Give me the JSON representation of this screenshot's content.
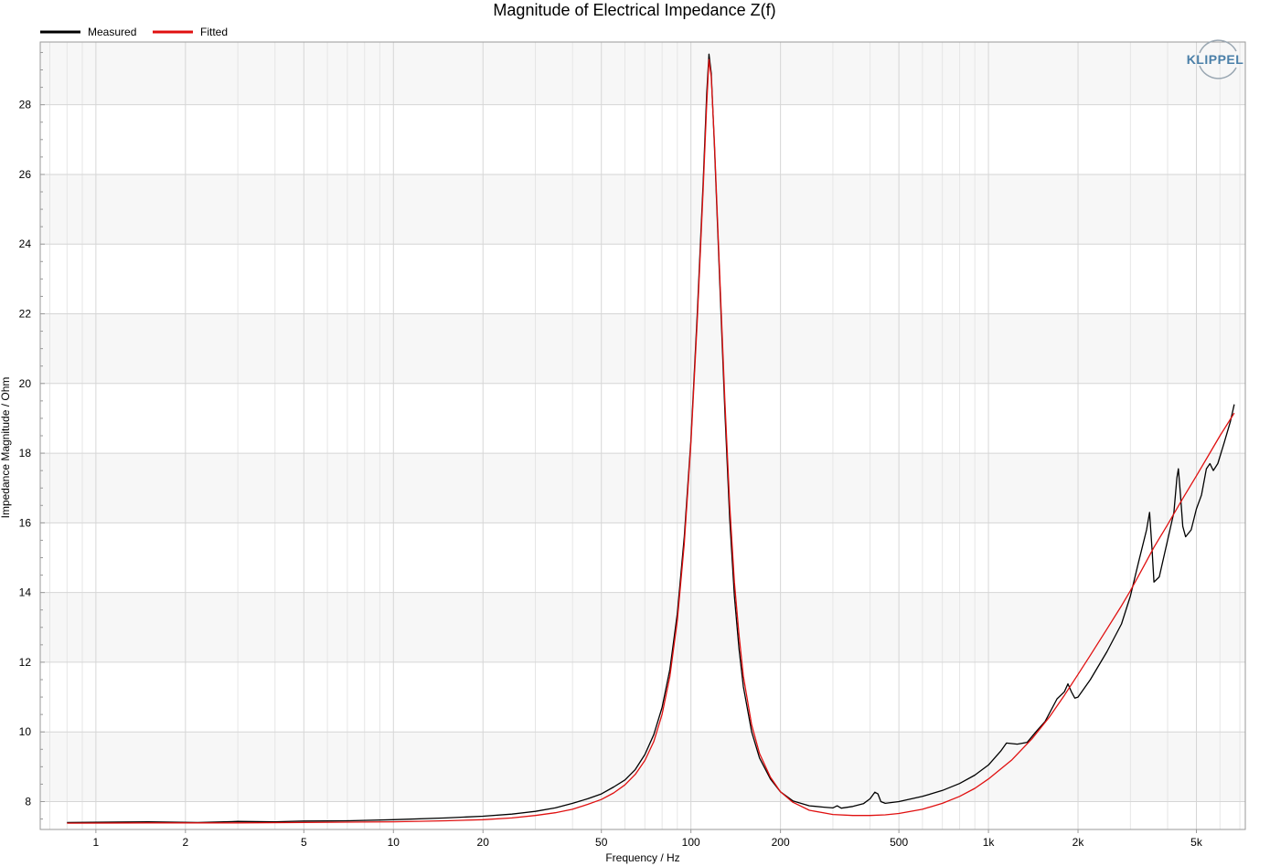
{
  "chart_data": {
    "type": "line",
    "title": "Magnitude of Electrical Impedance Z(f)",
    "xlabel": "Frequency / Hz",
    "ylabel": "Impedance Magnitude / Ohm",
    "x_scale": "log",
    "xlim": [
      0.65,
      7300
    ],
    "ylim": [
      7.2,
      29.8
    ],
    "grid": true,
    "legend_position": "top-left",
    "x_ticks": [
      {
        "value": 1,
        "label": "1"
      },
      {
        "value": 2,
        "label": "2"
      },
      {
        "value": 5,
        "label": "5"
      },
      {
        "value": 10,
        "label": "10"
      },
      {
        "value": 20,
        "label": "20"
      },
      {
        "value": 50,
        "label": "50"
      },
      {
        "value": 100,
        "label": "100"
      },
      {
        "value": 200,
        "label": "200"
      },
      {
        "value": 500,
        "label": "500"
      },
      {
        "value": 1000,
        "label": "1k"
      },
      {
        "value": 2000,
        "label": "2k"
      },
      {
        "value": 5000,
        "label": "5k"
      }
    ],
    "y_ticks": [
      8,
      10,
      12,
      14,
      16,
      18,
      20,
      22,
      24,
      26,
      28
    ],
    "series": [
      {
        "name": "Measured",
        "color": "#000000",
        "points": [
          [
            0.8,
            7.4
          ],
          [
            1.5,
            7.42
          ],
          [
            2.2,
            7.4
          ],
          [
            3,
            7.43
          ],
          [
            4,
            7.42
          ],
          [
            5,
            7.44
          ],
          [
            7,
            7.45
          ],
          [
            10,
            7.48
          ],
          [
            15,
            7.53
          ],
          [
            20,
            7.58
          ],
          [
            25,
            7.64
          ],
          [
            30,
            7.72
          ],
          [
            35,
            7.82
          ],
          [
            40,
            7.95
          ],
          [
            45,
            8.08
          ],
          [
            50,
            8.22
          ],
          [
            55,
            8.42
          ],
          [
            60,
            8.62
          ],
          [
            65,
            8.92
          ],
          [
            70,
            9.35
          ],
          [
            75,
            9.92
          ],
          [
            80,
            10.7
          ],
          [
            85,
            11.8
          ],
          [
            90,
            13.4
          ],
          [
            95,
            15.6
          ],
          [
            100,
            18.4
          ],
          [
            105,
            22.0
          ],
          [
            110,
            25.8
          ],
          [
            113,
            28.3
          ],
          [
            115,
            29.45
          ],
          [
            117,
            28.9
          ],
          [
            120,
            26.8
          ],
          [
            125,
            22.9
          ],
          [
            130,
            19.2
          ],
          [
            135,
            16.1
          ],
          [
            140,
            13.9
          ],
          [
            145,
            12.4
          ],
          [
            150,
            11.3
          ],
          [
            160,
            10.0
          ],
          [
            170,
            9.25
          ],
          [
            185,
            8.65
          ],
          [
            200,
            8.28
          ],
          [
            220,
            8.02
          ],
          [
            250,
            7.88
          ],
          [
            280,
            7.84
          ],
          [
            300,
            7.82
          ],
          [
            310,
            7.88
          ],
          [
            320,
            7.81
          ],
          [
            350,
            7.86
          ],
          [
            380,
            7.94
          ],
          [
            400,
            8.08
          ],
          [
            415,
            8.27
          ],
          [
            425,
            8.22
          ],
          [
            435,
            8.0
          ],
          [
            450,
            7.95
          ],
          [
            500,
            8.0
          ],
          [
            600,
            8.15
          ],
          [
            700,
            8.32
          ],
          [
            800,
            8.52
          ],
          [
            900,
            8.76
          ],
          [
            1000,
            9.05
          ],
          [
            1100,
            9.45
          ],
          [
            1150,
            9.68
          ],
          [
            1250,
            9.65
          ],
          [
            1350,
            9.7
          ],
          [
            1450,
            10.02
          ],
          [
            1550,
            10.3
          ],
          [
            1700,
            10.95
          ],
          [
            1800,
            11.15
          ],
          [
            1850,
            11.38
          ],
          [
            1900,
            11.15
          ],
          [
            1950,
            10.97
          ],
          [
            2000,
            11.0
          ],
          [
            2200,
            11.5
          ],
          [
            2500,
            12.3
          ],
          [
            2800,
            13.1
          ],
          [
            3000,
            13.9
          ],
          [
            3200,
            14.9
          ],
          [
            3400,
            15.8
          ],
          [
            3480,
            16.3
          ],
          [
            3550,
            15.2
          ],
          [
            3600,
            14.3
          ],
          [
            3750,
            14.45
          ],
          [
            4000,
            15.5
          ],
          [
            4200,
            16.3
          ],
          [
            4300,
            17.3
          ],
          [
            4350,
            17.55
          ],
          [
            4420,
            16.8
          ],
          [
            4500,
            15.9
          ],
          [
            4600,
            15.6
          ],
          [
            4800,
            15.8
          ],
          [
            5000,
            16.4
          ],
          [
            5200,
            16.8
          ],
          [
            5400,
            17.55
          ],
          [
            5550,
            17.7
          ],
          [
            5700,
            17.5
          ],
          [
            5900,
            17.7
          ],
          [
            6200,
            18.3
          ],
          [
            6500,
            18.9
          ],
          [
            6700,
            19.4
          ]
        ]
      },
      {
        "name": "Fitted",
        "color": "#e01010",
        "points": [
          [
            0.8,
            7.38
          ],
          [
            1.5,
            7.39
          ],
          [
            3,
            7.39
          ],
          [
            5,
            7.4
          ],
          [
            7,
            7.41
          ],
          [
            10,
            7.42
          ],
          [
            15,
            7.45
          ],
          [
            20,
            7.48
          ],
          [
            25,
            7.53
          ],
          [
            30,
            7.6
          ],
          [
            35,
            7.68
          ],
          [
            40,
            7.78
          ],
          [
            45,
            7.92
          ],
          [
            50,
            8.06
          ],
          [
            55,
            8.25
          ],
          [
            60,
            8.48
          ],
          [
            65,
            8.78
          ],
          [
            70,
            9.18
          ],
          [
            75,
            9.72
          ],
          [
            80,
            10.5
          ],
          [
            85,
            11.6
          ],
          [
            90,
            13.2
          ],
          [
            95,
            15.4
          ],
          [
            100,
            18.3
          ],
          [
            105,
            21.8
          ],
          [
            110,
            25.6
          ],
          [
            113,
            28.0
          ],
          [
            115,
            29.3
          ],
          [
            117,
            28.8
          ],
          [
            120,
            26.9
          ],
          [
            125,
            23.1
          ],
          [
            130,
            19.5
          ],
          [
            135,
            16.5
          ],
          [
            140,
            14.3
          ],
          [
            145,
            12.8
          ],
          [
            150,
            11.6
          ],
          [
            160,
            10.2
          ],
          [
            170,
            9.38
          ],
          [
            185,
            8.7
          ],
          [
            200,
            8.28
          ],
          [
            220,
            7.98
          ],
          [
            250,
            7.75
          ],
          [
            300,
            7.63
          ],
          [
            350,
            7.6
          ],
          [
            400,
            7.6
          ],
          [
            450,
            7.62
          ],
          [
            500,
            7.66
          ],
          [
            600,
            7.78
          ],
          [
            700,
            7.95
          ],
          [
            800,
            8.15
          ],
          [
            900,
            8.38
          ],
          [
            1000,
            8.65
          ],
          [
            1200,
            9.2
          ],
          [
            1400,
            9.8
          ],
          [
            1600,
            10.42
          ],
          [
            1800,
            11.05
          ],
          [
            2000,
            11.65
          ],
          [
            2200,
            12.2
          ],
          [
            2500,
            12.95
          ],
          [
            2800,
            13.62
          ],
          [
            3000,
            14.05
          ],
          [
            3300,
            14.7
          ],
          [
            3600,
            15.3
          ],
          [
            4000,
            15.95
          ],
          [
            4500,
            16.7
          ],
          [
            5000,
            17.35
          ],
          [
            5500,
            17.95
          ],
          [
            6000,
            18.5
          ],
          [
            6700,
            19.15
          ]
        ]
      }
    ]
  },
  "logo": {
    "text": "KLIPPEL"
  },
  "colors": {
    "plot_band_light": "#f7f7f7",
    "plot_band_white": "#ffffff",
    "grid_major": "#d6d6d6",
    "grid_minor": "#e6e6e6",
    "axis": "#9a9a9a",
    "logo_blue": "#4a7fa8",
    "logo_gray": "#9aa7b2"
  }
}
